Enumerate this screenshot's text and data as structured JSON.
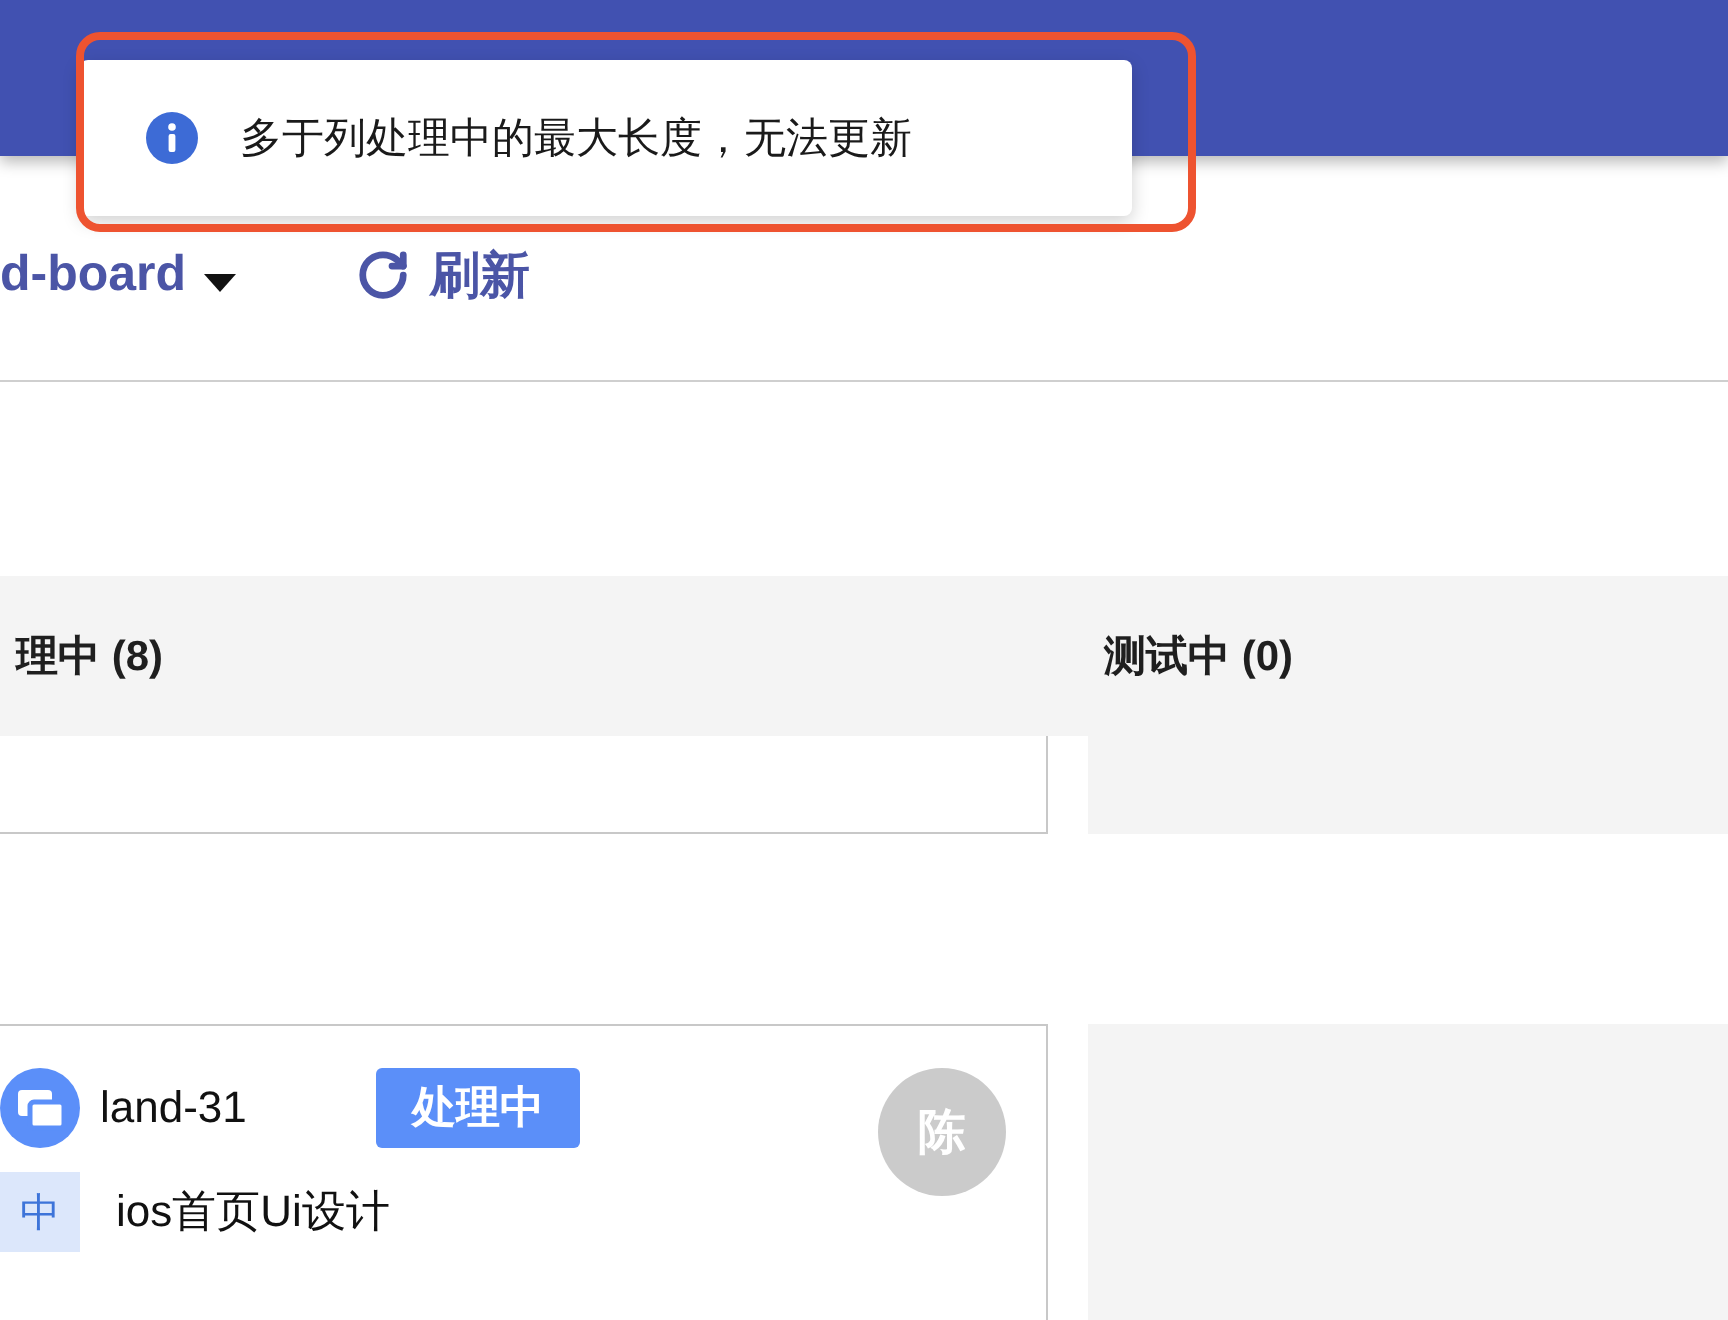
{
  "toast": {
    "kind": "info",
    "message": "多于列处理中的最大长度，无法更新",
    "highlighted": true
  },
  "toolbar": {
    "board_selector": "d-board",
    "refresh_button": "刷新"
  },
  "columns": [
    {
      "title": "理中 (8)"
    },
    {
      "title": "测试中 (0)"
    }
  ],
  "lanes": [
    {
      "cards": [
        {
          "kind": "clipped"
        }
      ]
    },
    {
      "cards": [
        {
          "kind": "task",
          "key": "land-31",
          "status": "处理中",
          "priority": "中",
          "title": "ios首页Ui设计",
          "assignee": "陈"
        }
      ]
    }
  ]
}
